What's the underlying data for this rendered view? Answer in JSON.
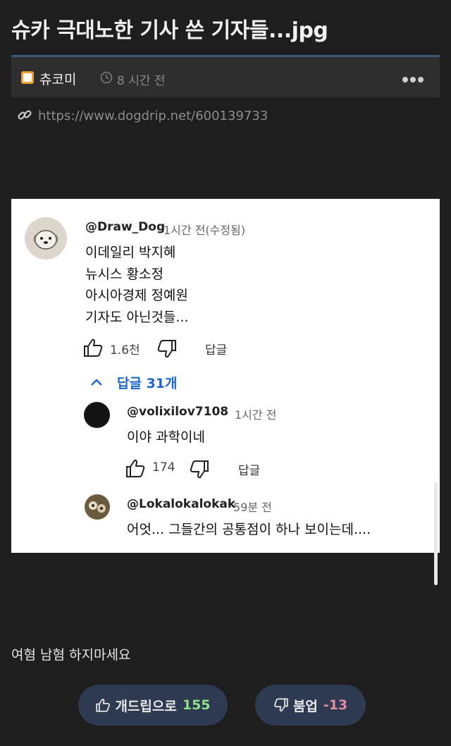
{
  "post": {
    "title": "슈카 극대노한 기사 쓴 기자들...jpg",
    "author": "츄코미",
    "time": "8 시간 전",
    "source_url": "https://www.dogdrip.net/600139733",
    "body_text": "여혐 남혐 하지마세요"
  },
  "screenshot": {
    "comment": {
      "handle": "@Draw_Dog",
      "time": "1시간 전(수정됨)",
      "lines": [
        "이데일리 박지혜",
        "뉴시스 황소정",
        "아시아경제 정예원",
        "기자도 아닌것들..."
      ],
      "likes": "1.6천",
      "reply_label": "답글"
    },
    "replies_toggle": "답글 31개",
    "replies": [
      {
        "handle": "@volixilov7108",
        "time": "1시간 전",
        "text": "이야 과학이네",
        "likes": "174",
        "reply_label": "답글"
      },
      {
        "handle": "@Lokalokalokak",
        "time": "59분 전",
        "text": "어엇... 그들간의 공통점이 하나 보이는데...."
      }
    ]
  },
  "votes": {
    "up_label": "개드립으로",
    "up_count": "155",
    "down_label": "붐업",
    "down_count": "-13"
  },
  "colors": {
    "background": "#1e1e1e",
    "meta_bar": "#2e2e2e",
    "accent_border": "#3c5a78",
    "vote_button": "#2d3a52",
    "up_count": "#8fe08a",
    "down_count": "#e08aa0",
    "reply_link": "#1a66cc"
  },
  "icons": [
    "category-icon",
    "clock-icon",
    "more-icon",
    "link-icon",
    "thumb-up-icon",
    "thumb-down-icon",
    "chevron-up-icon"
  ]
}
